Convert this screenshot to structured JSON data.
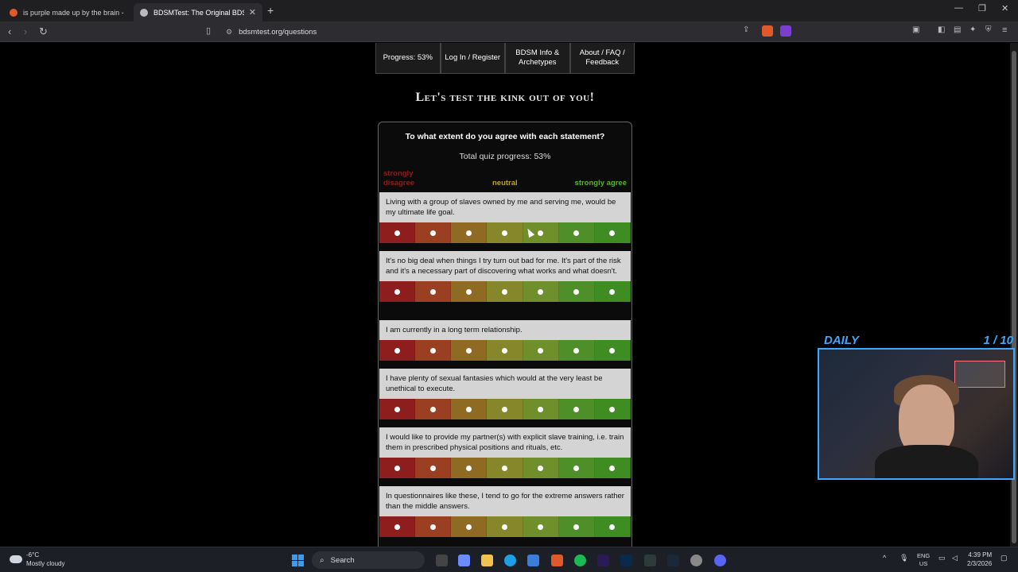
{
  "browser": {
    "tabs": [
      {
        "title": "is purple made up by the brain - Brav",
        "active": false
      },
      {
        "title": "BDSMTest: The Original BDSM &",
        "active": true
      }
    ],
    "url": "bdsmtest.org/questions"
  },
  "nav": {
    "progress": "Progress: 53%",
    "login": "Log In / Register",
    "info": "BDSM Info & Archetypes",
    "about": "About / FAQ / Feedback"
  },
  "headline": "Let's test the kink out of you!",
  "quiz": {
    "title": "To what extent do you agree with each statement?",
    "progress_text": "Total quiz progress: 53%",
    "scale": {
      "disagree": "strongly disagree",
      "neutral": "neutral",
      "agree": "strongly agree"
    },
    "questions": [
      {
        "text": "Living with a group of slaves owned by me and serving me, would be my ultimate life goal."
      },
      {
        "text": "It's no big deal when things I try turn out bad for me. It's part of the risk and it's a necessary part of discovering what works and what doesn't."
      },
      {
        "text": "I am currently in a long term relationship."
      },
      {
        "text": "I have plenty of sexual fantasies which would at the very least be unethical to execute."
      },
      {
        "text": "I would like to provide my partner(s) with explicit slave training, i.e. train them in prescribed physical positions and rituals, etc."
      },
      {
        "text": "In questionnaires like these, I tend to go for the extreme answers rather than the middle answers."
      }
    ]
  },
  "overlay": {
    "label": "DAILY",
    "counter": "1 / 10"
  },
  "taskbar": {
    "temperature": "-6°C",
    "weather": "Mostly cloudy",
    "search": "Search",
    "lang_line1": "ENG",
    "lang_line2": "US",
    "time": "4:39 PM",
    "date": "2/3/2026"
  },
  "colors": {
    "scale": [
      "#8e1d1d",
      "#9a3f22",
      "#8f6a23",
      "#86872a",
      "#6e8f2b",
      "#4f8f2a",
      "#3f8c22"
    ],
    "overlay_accent": "#3fa7ff"
  }
}
